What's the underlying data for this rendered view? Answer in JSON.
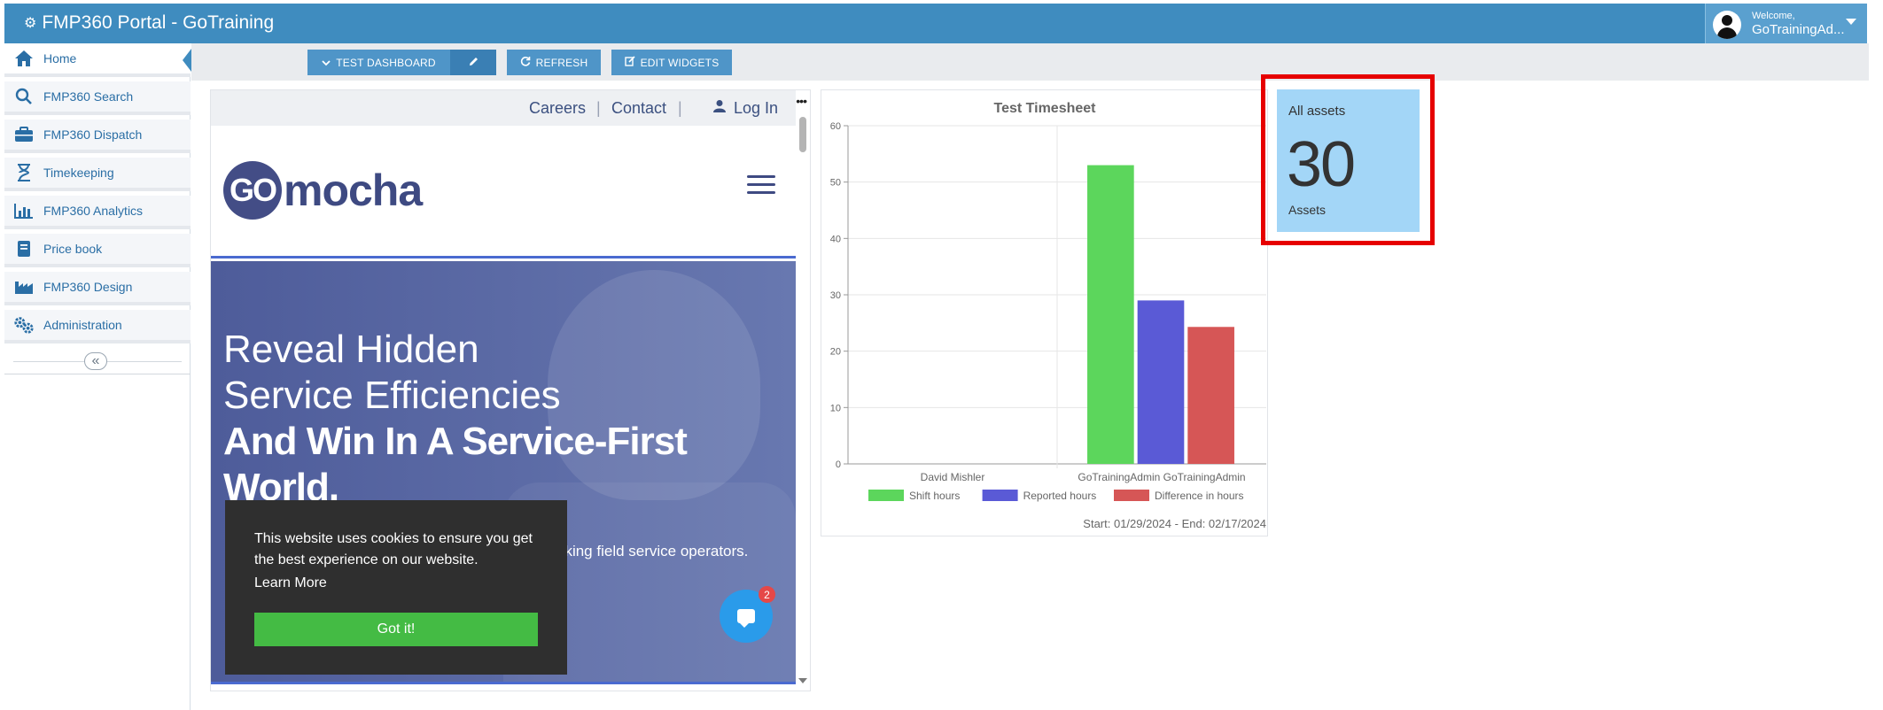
{
  "app": {
    "title": "FMP360 Portal - GoTraining"
  },
  "user": {
    "welcome": "Welcome,",
    "name": "GoTrainingAd..."
  },
  "sidebar": {
    "items": [
      {
        "label": "Home",
        "icon": "home-icon",
        "active": true
      },
      {
        "label": "FMP360 Search",
        "icon": "search-icon"
      },
      {
        "label": "FMP360 Dispatch",
        "icon": "briefcase-icon"
      },
      {
        "label": "Timekeeping",
        "icon": "hourglass-icon"
      },
      {
        "label": "FMP360 Analytics",
        "icon": "bar-chart-icon"
      },
      {
        "label": "Price book",
        "icon": "book-icon"
      },
      {
        "label": "FMP360 Design",
        "icon": "factory-icon"
      },
      {
        "label": "Administration",
        "icon": "gears-icon"
      }
    ],
    "collapse_glyph": "«"
  },
  "toolbar": {
    "dashboard_label": "TEST DASHBOARD",
    "refresh_label": "REFRESH",
    "edit_widgets_label": "EDIT WIDGETS"
  },
  "website": {
    "nav": {
      "careers": "Careers",
      "contact": "Contact",
      "login": "Log In"
    },
    "logo": {
      "go": "GO",
      "rest": "mocha"
    },
    "hero": {
      "line1": "Reveal Hidden",
      "line2": "Service Efficiencies",
      "line3": "And Win In A Service-First",
      "line4": "World.",
      "sub": "oking field service operators."
    },
    "cookie": {
      "message": "This website uses cookies to ensure you get the best experience on our website.",
      "learn_more": "Learn More",
      "accept": "Got it!"
    },
    "chat_badge": "2"
  },
  "chart_data": {
    "type": "bar",
    "title": "Test Timesheet",
    "categories": [
      "David Mishler",
      "GoTrainingAdmin GoTrainingAdmin"
    ],
    "series": [
      {
        "name": "Shift hours",
        "color": "#5cd65c",
        "values": [
          0,
          53
        ]
      },
      {
        "name": "Reported hours",
        "color": "#5a5ad6",
        "values": [
          0,
          29
        ]
      },
      {
        "name": "Difference in hours",
        "color": "#d65656",
        "values": [
          0,
          24.3
        ]
      }
    ],
    "ylim": [
      0,
      60
    ],
    "yticks": [
      "0",
      "10",
      "20",
      "30",
      "40",
      "50",
      "60"
    ],
    "grid": true,
    "legend": "bottom",
    "footer": "Start: 01/29/2024 - End: 02/17/2024"
  },
  "assets_widget": {
    "label": "All assets",
    "value": "30",
    "unit": "Assets",
    "bg": "#a3d6f7"
  }
}
